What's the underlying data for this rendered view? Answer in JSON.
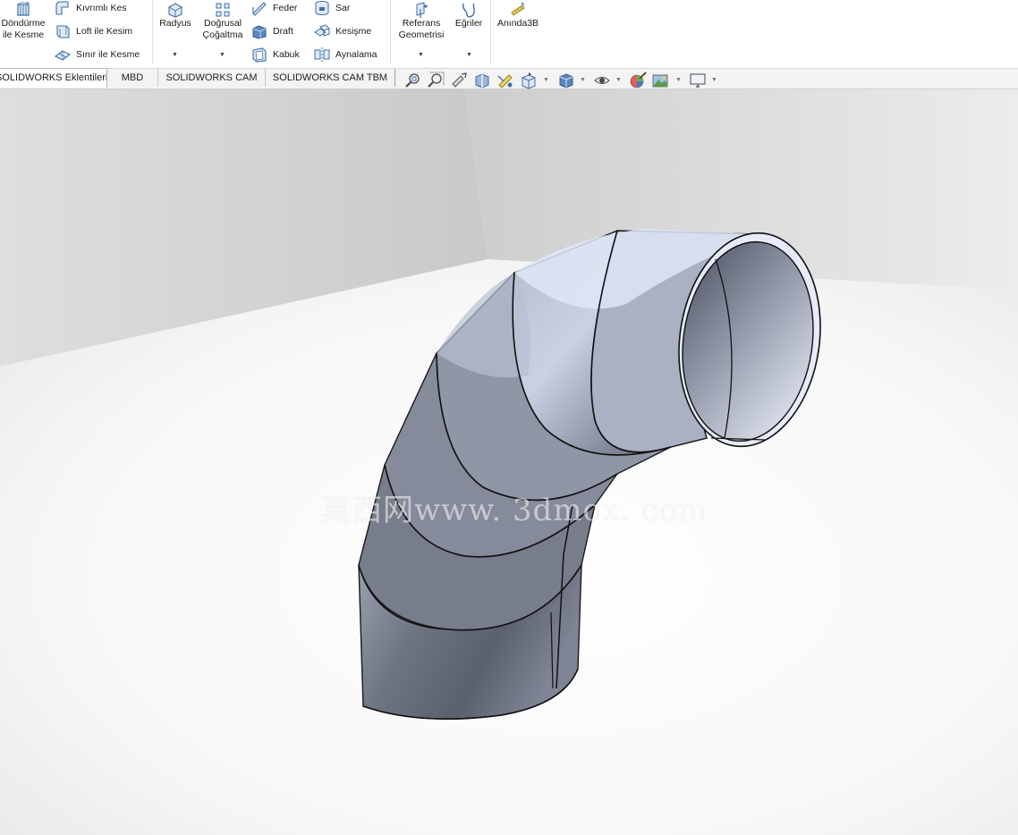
{
  "ribbon": {
    "revolve_cut": {
      "line1": "Döndürme",
      "line2": "ile Kesme"
    },
    "swept_cut": "Kıvrımlı Kes",
    "loft_cut": "Loft ile Kesim",
    "boundary_cut": "Sınır ile Kesme",
    "fillet": "Radyus",
    "linear_pattern": {
      "line1": "Doğrusal",
      "line2": "Çoğaltma"
    },
    "rib": "Feder",
    "draft": "Draft",
    "shell": "Kabuk",
    "wrap": "Sar",
    "intersect": "Kesişme",
    "mirror": "Aynalama",
    "reference_geometry": {
      "line1": "Referans",
      "line2": "Geometrisi"
    },
    "curves": "Eğriler",
    "instant3d": "Anında3B"
  },
  "tabs": [
    {
      "label": "SOLIDWORKS Eklentileri",
      "active": true
    },
    {
      "label": "MBD",
      "active": false
    },
    {
      "label": "SOLIDWORKS CAM",
      "active": false
    },
    {
      "label": "SOLIDWORKS CAM TBM",
      "active": false
    }
  ],
  "view_toolbar": {
    "icons": [
      "zoom-to-fit-icon",
      "zoom-to-area-icon",
      "previous-view-icon",
      "section-view-icon",
      "dynamic-annotation-icon",
      "view-orientation-icon",
      "display-style-icon",
      "hide-show-items-icon",
      "edit-appearance-icon",
      "apply-scene-icon",
      "view-settings-icon"
    ]
  },
  "viewport": {
    "watermark": "莫西网www. 3dmox. com",
    "model": "segmented-elbow-duct"
  },
  "colors": {
    "ribbon_bg": "#ffffff",
    "tab_bg": "#f3f3f3",
    "icon_blue": "#3d6fa8",
    "pipe_dark": "#5e6472",
    "pipe_light": "#dfe6f7"
  }
}
